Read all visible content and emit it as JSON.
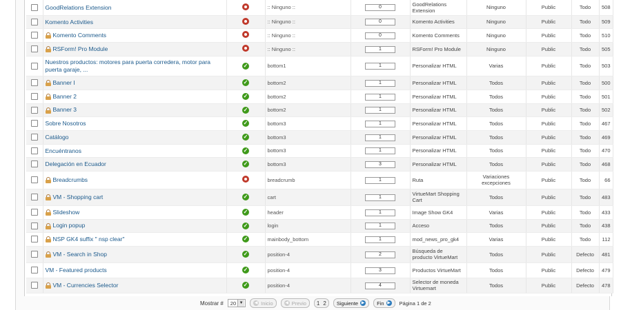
{
  "rows": [
    {
      "title": "GoodRelations Extension",
      "locked": false,
      "enabled": false,
      "position": ":: Ninguno ::",
      "order": "0",
      "type": "GoodRelations Extension",
      "pages": "Ninguno",
      "access": "Public",
      "language": "Todo",
      "id": "508"
    },
    {
      "title": "Komento Activities",
      "locked": false,
      "enabled": false,
      "position": ":: Ninguno ::",
      "order": "0",
      "type": "Komento Activities",
      "pages": "Ninguno",
      "access": "Public",
      "language": "Todo",
      "id": "509"
    },
    {
      "title": "Komento Comments",
      "locked": true,
      "enabled": false,
      "position": ":: Ninguno ::",
      "order": "0",
      "type": "Komento Comments",
      "pages": "Ninguno",
      "access": "Public",
      "language": "Todo",
      "id": "510"
    },
    {
      "title": "RSForm! Pro Module",
      "locked": true,
      "enabled": false,
      "position": ":: Ninguno ::",
      "order": "1",
      "type": "RSForm! Pro Module",
      "pages": "Ninguno",
      "access": "Public",
      "language": "Todo",
      "id": "505"
    },
    {
      "title": "Nuestros productos: motores para puerta corredera, motor para puerta garaje, ...",
      "locked": false,
      "enabled": true,
      "position": "bottom1",
      "order": "1",
      "type": "Personalizar HTML",
      "pages": "Varias",
      "access": "Public",
      "language": "Todo",
      "id": "503"
    },
    {
      "title": "Banner I",
      "locked": true,
      "enabled": true,
      "position": "bottom2",
      "order": "1",
      "type": "Personalizar HTML",
      "pages": "Todos",
      "access": "Public",
      "language": "Todo",
      "id": "500"
    },
    {
      "title": "Banner 2",
      "locked": true,
      "enabled": true,
      "position": "bottom2",
      "order": "1",
      "type": "Personalizar HTML",
      "pages": "Todos",
      "access": "Public",
      "language": "Todo",
      "id": "501"
    },
    {
      "title": "Banner 3",
      "locked": true,
      "enabled": true,
      "position": "bottom2",
      "order": "1",
      "type": "Personalizar HTML",
      "pages": "Todos",
      "access": "Public",
      "language": "Todo",
      "id": "502"
    },
    {
      "title": "Sobre Nosotros",
      "locked": false,
      "enabled": true,
      "position": "bottom3",
      "order": "1",
      "type": "Personalizar HTML",
      "pages": "Todos",
      "access": "Public",
      "language": "Todo",
      "id": "467"
    },
    {
      "title": "Catálogo",
      "locked": false,
      "enabled": true,
      "position": "bottom3",
      "order": "1",
      "type": "Personalizar HTML",
      "pages": "Todos",
      "access": "Public",
      "language": "Todo",
      "id": "469"
    },
    {
      "title": "Encuéntranos",
      "locked": false,
      "enabled": true,
      "position": "bottom3",
      "order": "1",
      "type": "Personalizar HTML",
      "pages": "Todos",
      "access": "Public",
      "language": "Todo",
      "id": "470"
    },
    {
      "title": "Delegación en Ecuador",
      "locked": false,
      "enabled": true,
      "position": "bottom3",
      "order": "3",
      "type": "Personalizar HTML",
      "pages": "Todos",
      "access": "Public",
      "language": "Todo",
      "id": "468"
    },
    {
      "title": "Breadcrumbs",
      "locked": true,
      "enabled": false,
      "position": "breadcrumb",
      "order": "1",
      "type": "Ruta",
      "pages": "Variaciones excepciones",
      "access": "Public",
      "language": "Todo",
      "id": "66"
    },
    {
      "title": "VM - Shopping cart",
      "locked": true,
      "enabled": true,
      "position": "cart",
      "order": "1",
      "type": "VirtueMart Shopping Cart",
      "pages": "Todos",
      "access": "Public",
      "language": "Todo",
      "id": "483"
    },
    {
      "title": "Slideshow",
      "locked": true,
      "enabled": true,
      "position": "header",
      "order": "1",
      "type": "Image Show GK4",
      "pages": "Varias",
      "access": "Public",
      "language": "Todo",
      "id": "433"
    },
    {
      "title": "Login popup",
      "locked": true,
      "enabled": true,
      "position": "login",
      "order": "1",
      "type": "Acceso",
      "pages": "Todos",
      "access": "Public",
      "language": "Todo",
      "id": "438"
    },
    {
      "title": "NSP GK4 suffix \" nsp clear\"",
      "locked": true,
      "enabled": true,
      "position": "mainbody_bottom",
      "order": "1",
      "type": "mod_news_pro_gk4",
      "pages": "Varias",
      "access": "Public",
      "language": "Todo",
      "id": "112"
    },
    {
      "title": "VM - Search in Shop",
      "locked": true,
      "enabled": true,
      "position": "position-4",
      "order": "2",
      "type": "Búsqueda de producto VirtueMart",
      "pages": "Todos",
      "access": "Public",
      "language": "Defecto",
      "id": "481"
    },
    {
      "title": "VM - Featured products",
      "locked": false,
      "enabled": true,
      "position": "position-4",
      "order": "3",
      "type": "Productos VirtueMart",
      "pages": "Todos",
      "access": "Public",
      "language": "Defecto",
      "id": "479"
    },
    {
      "title": "VM - Currencies Selector",
      "locked": true,
      "enabled": true,
      "position": "position-4",
      "order": "4",
      "type": "Selector de moneda Virtuemart",
      "pages": "Todos",
      "access": "Public",
      "language": "Defecto",
      "id": "478"
    }
  ],
  "pagination": {
    "limit_label": "Mostrar #",
    "limit_value": "20",
    "start_label": "Inicio",
    "prev_label": "Previo",
    "page_1": "1",
    "page_2": "2",
    "next_label": "Siguiente",
    "end_label": "Fin",
    "page_info": "Página 1 de 2"
  },
  "colors": {
    "enabled": "#3f9a1a",
    "disabled": "#c0392b",
    "link": "#1c5a8c"
  }
}
